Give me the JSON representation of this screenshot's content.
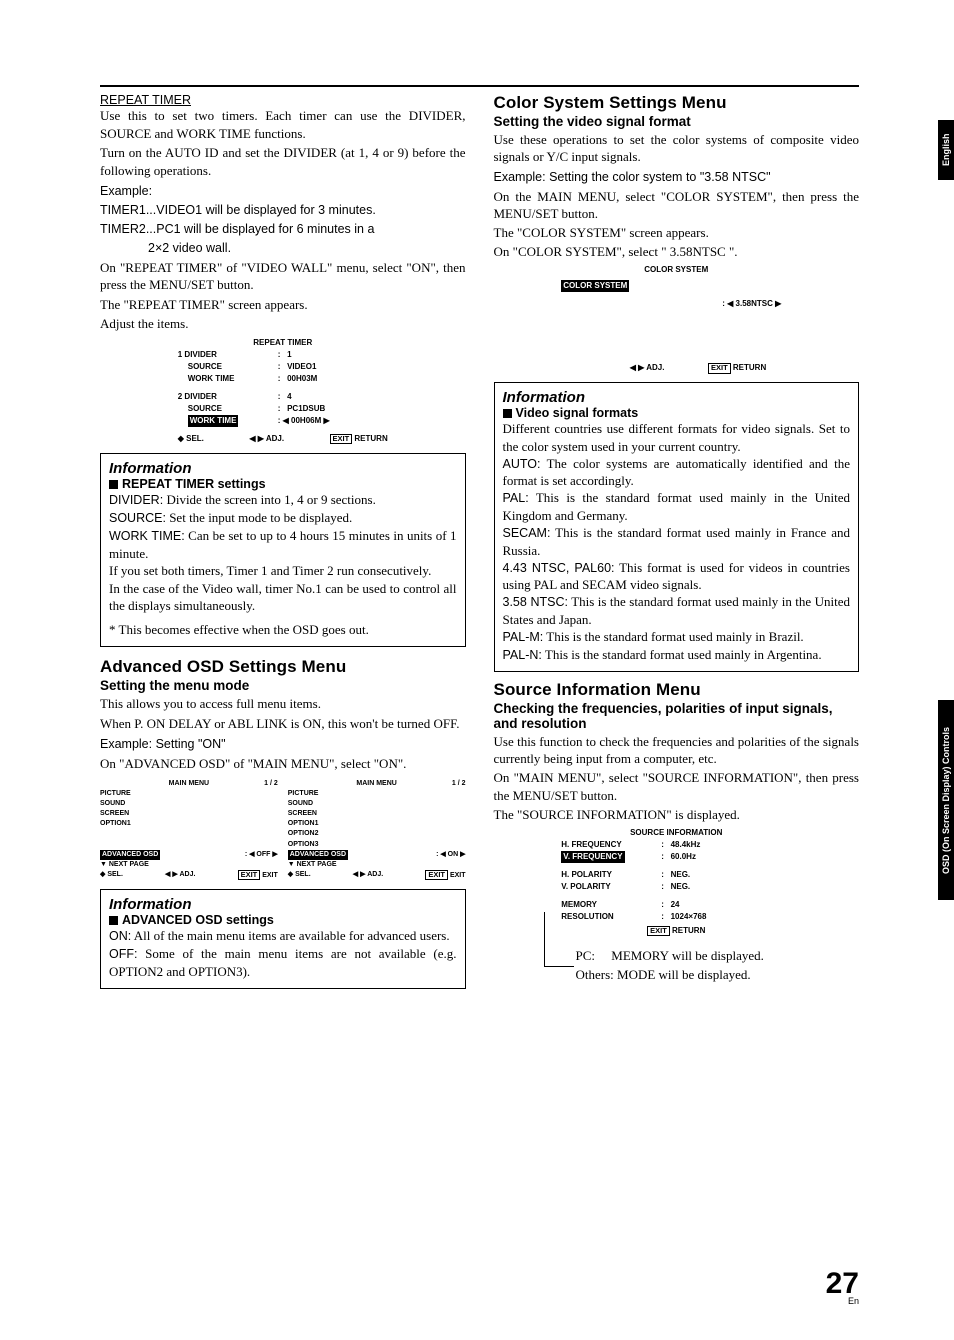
{
  "sideTabs": {
    "english": "English",
    "osd": "OSD (On Screen Display) Controls"
  },
  "pageNum": {
    "num": "27",
    "en": "En"
  },
  "left": {
    "repeatTimer": {
      "title": "REPEAT TIMER",
      "p1": "Use this to set two timers. Each timer can use the DIVIDER, SOURCE and WORK TIME functions.",
      "p2": "Turn on the AUTO ID and set the DIVIDER (at 1, 4 or 9) before the following operations.",
      "example": "Example:",
      "t1": "TIMER1...VIDEO1 will be displayed for 3 minutes.",
      "t2a": "TIMER2...PC1 will be displayed for 6 minutes in a",
      "t2b": "2×2 video wall.",
      "p3": "On \"REPEAT TIMER\" of \"VIDEO WALL\" menu, select \"ON\", then press the MENU/SET button.",
      "p4": "The \"REPEAT TIMER\" screen appears.",
      "p5": "Adjust the items."
    },
    "osdRepeat": {
      "title": "REPEAT TIMER",
      "r1": {
        "divider": "1  DIVIDER",
        "div_v": "1",
        "source": "SOURCE",
        "source_v": "VIDEO1",
        "work": "WORK TIME",
        "work_v": "00H03M"
      },
      "r2": {
        "divider": "2  DIVIDER",
        "div_v": "4",
        "source": "SOURCE",
        "source_v": "PC1DSUB",
        "work": "WORK TIME",
        "work_v": "00H06M"
      },
      "footer": {
        "sel": "SEL.",
        "adj": "ADJ.",
        "exit": "EXIT",
        "ret": "RETURN"
      }
    },
    "infoRepeat": {
      "title": "Information",
      "sub": "REPEAT TIMER settings",
      "div_l": "DIVIDER:",
      "div_t": " Divide the screen into 1, 4 or 9 sections.",
      "src_l": "SOURCE:",
      "src_t": " Set the input mode to be displayed.",
      "wrk_l": "WORK TIME:",
      "wrk_t": " Can be set to up to 4 hours 15 minutes in units of 1 minute.",
      "p1": "If you set both timers, Timer 1 and Timer 2 run consecutively.",
      "p2": "In the case of the Video wall, timer No.1 can be used to control all the displays simultaneously.",
      "p3": "* This becomes effective when the OSD goes out."
    },
    "advOsd": {
      "title": "Advanced OSD Settings Menu",
      "sub": "Setting the menu mode",
      "p1": "This allows you to access full menu items.",
      "p2": "When P. ON DELAY or ABL LINK is ON, this won't be turned OFF.",
      "example": "Example: Setting \"ON\"",
      "p3": "On \"ADVANCED OSD\" of \"MAIN MENU\", select \"ON\"."
    },
    "mainMenuL": {
      "title": "MAIN MENU",
      "page": "1 / 2",
      "items": [
        "PICTURE",
        "SOUND",
        "SCREEN",
        "OPTION1"
      ],
      "adv": "ADVANCED OSD",
      "adv_v": "OFF",
      "next": "NEXT PAGE",
      "sel": "SEL.",
      "adj": "ADJ.",
      "exit": "EXIT",
      "exit2": "EXIT"
    },
    "mainMenuR": {
      "title": "MAIN MENU",
      "page": "1 / 2",
      "items": [
        "PICTURE",
        "SOUND",
        "SCREEN",
        "OPTION1",
        "OPTION2",
        "OPTION3"
      ],
      "adv": "ADVANCED OSD",
      "adv_v": "ON",
      "next": "NEXT PAGE",
      "sel": "SEL.",
      "adj": "ADJ.",
      "exit": "EXIT",
      "exit2": "EXIT"
    },
    "infoAdv": {
      "title": "Information",
      "sub": "ADVANCED OSD settings",
      "on_l": "ON:",
      "on_t": " All of the main menu items are available for advanced users.",
      "off_l": "OFF:",
      "off_t": " Some of the main menu items are not available (e.g. OPTION2 and OPTION3)."
    }
  },
  "right": {
    "colorSys": {
      "title": "Color System Settings Menu",
      "sub": "Setting the video signal format",
      "p1": "Use these operations to set the color systems of composite video signals or Y/C input signals.",
      "example": "Example: Setting the color system to \"3.58 NTSC\"",
      "p2": "On the MAIN MENU, select \"COLOR SYSTEM\", then press the MENU/SET button.",
      "p3": "The \"COLOR SYSTEM\" screen appears.",
      "p4": "On \"COLOR SYSTEM\", select \" 3.58NTSC \"."
    },
    "osdColor": {
      "title": "COLOR SYSTEM",
      "row": "COLOR SYSTEM",
      "val": "3.58NTSC",
      "adj": "ADJ.",
      "exit": "EXIT",
      "ret": "RETURN"
    },
    "infoVideo": {
      "title": "Information",
      "sub": "Video signal formats",
      "p1": "Different countries use different formats for video signals. Set to the color system used in your current country.",
      "auto_l": "AUTO:",
      "auto_t": " The color systems are automatically identified and the format is set accordingly.",
      "pal_l": "PAL:",
      "pal_t": " This is the standard format used mainly in the United Kingdom and Germany.",
      "secam_l": "SECAM:",
      "secam_t": " This is the standard format used mainly in France and Russia.",
      "n443_l": "4.43 NTSC, PAL60:",
      "n443_t": " This format is used for videos in countries using PAL and SECAM video signals.",
      "n358_l": "3.58 NTSC:",
      "n358_t": " This is the standard format used mainly in the United States and Japan.",
      "palm_l": "PAL-M:",
      "palm_t": " This is the standard format used mainly in Brazil.",
      "paln_l": "PAL-N:",
      "paln_t": " This is the standard format used mainly in Argentina."
    },
    "srcInfo": {
      "title": "Source Information Menu",
      "sub": "Checking the frequencies, polarities of input signals, and resolution",
      "p1": "Use this function to check the frequencies and polarities of the signals currently being input from a computer, etc.",
      "p2": "On \"MAIN MENU\", select \"SOURCE INFORMATION\", then press the MENU/SET button.",
      "p3": "The \"SOURCE INFORMATION\" is displayed."
    },
    "osdSrc": {
      "title": "SOURCE INFORMATION",
      "rows": [
        {
          "l": "H. FREQUENCY",
          "v": "48.4kHz"
        },
        {
          "l": "V. FREQUENCY",
          "v": "60.0Hz",
          "hl": true
        }
      ],
      "rows2": [
        {
          "l": "H. POLARITY",
          "v": "NEG."
        },
        {
          "l": "V. POLARITY",
          "v": "NEG."
        }
      ],
      "rows3": [
        {
          "l": "MEMORY",
          "v": "24"
        },
        {
          "l": "RESOLUTION",
          "v": "1024×768"
        }
      ],
      "exit": "EXIT",
      "ret": "RETURN"
    },
    "notes": {
      "pc": "PC:",
      "pc_t": "MEMORY will be displayed.",
      "oth": "Others: MODE will be displayed."
    }
  }
}
